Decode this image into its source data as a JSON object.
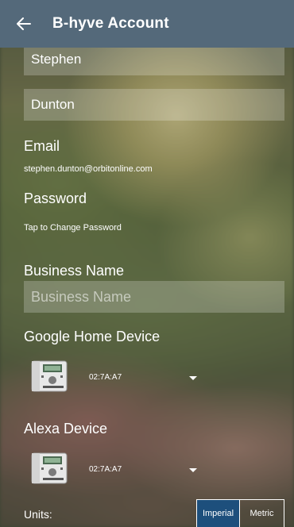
{
  "header": {
    "title": "B-hyve Account"
  },
  "form": {
    "first_name_value": "Stephen",
    "last_name_value": "Dunton",
    "email_label": "Email",
    "email_value": "stephen.dunton@orbitonline.com",
    "password_label": "Password",
    "password_hint": "Tap to Change Password",
    "business_label": "Business Name",
    "business_placeholder": "Business Name"
  },
  "google": {
    "label": "Google Home Device",
    "device_id": "02:7A:A7"
  },
  "alexa": {
    "label": "Alexa Device",
    "device_id": "02:7A:A7"
  },
  "units": {
    "label": "Units:",
    "options": [
      "Imperial",
      "Metric"
    ],
    "selected": "Imperial"
  },
  "icons": {
    "back": "arrow-left-icon",
    "device": "sprinkler-controller-icon",
    "dropdown": "dropdown-caret-icon"
  },
  "colors": {
    "header_bg": "#54697a",
    "active_segment": "#1d4f7c"
  }
}
